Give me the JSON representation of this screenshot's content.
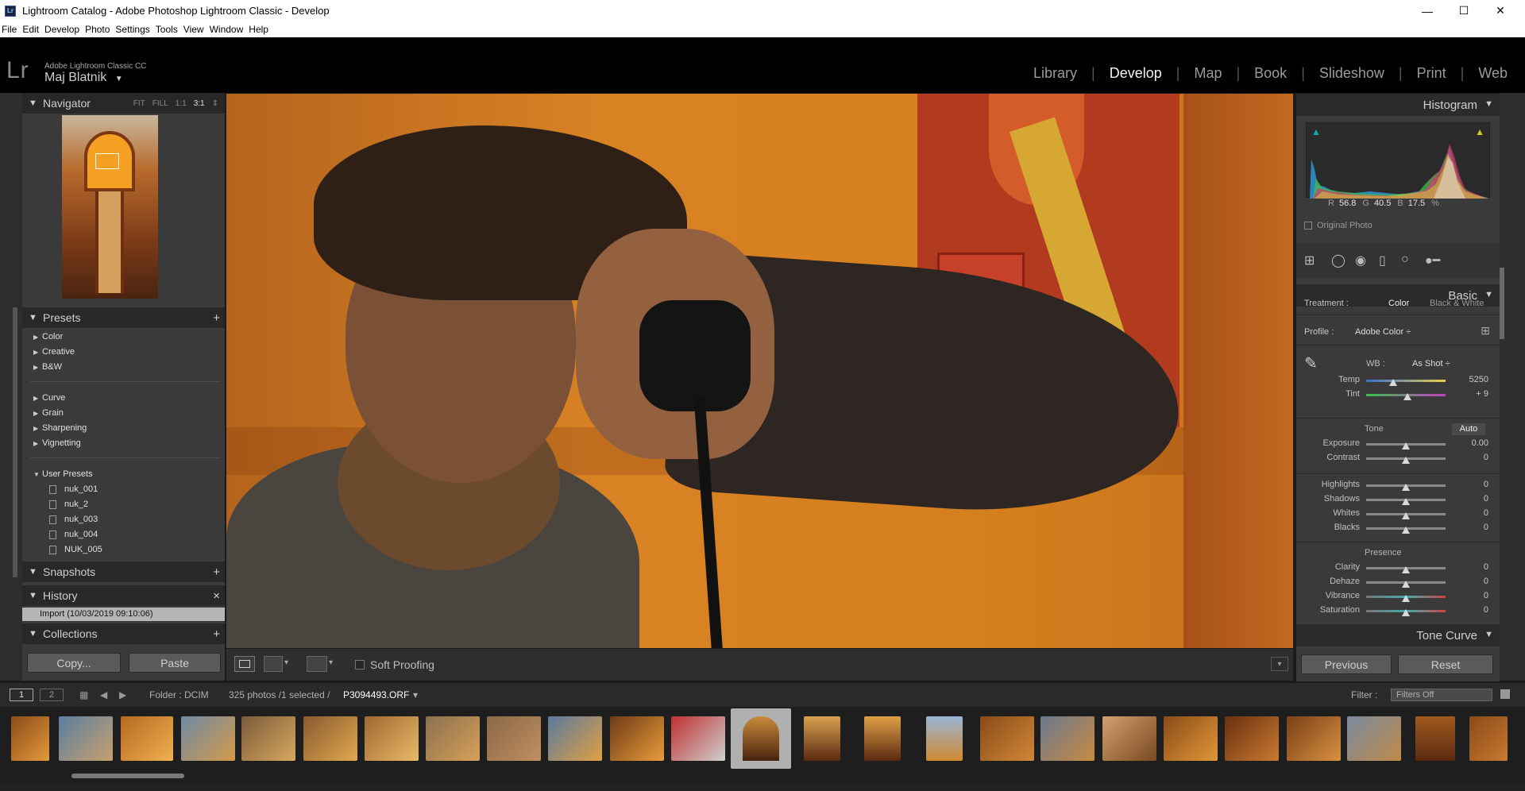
{
  "window": {
    "title": "Lightroom Catalog - Adobe Photoshop Lightroom Classic - Develop",
    "minimize": "—",
    "maximize": "☐",
    "close": "✕",
    "app_badge": "Lr"
  },
  "menu": [
    "File",
    "Edit",
    "Develop",
    "Photo",
    "Settings",
    "Tools",
    "View",
    "Window",
    "Help"
  ],
  "identity": {
    "logo": "Lr",
    "app_name": "Adobe Lightroom Classic CC",
    "user": "Maj Blatnik",
    "user_caret": "▼"
  },
  "modules": [
    "Library",
    "Develop",
    "Map",
    "Book",
    "Slideshow",
    "Print",
    "Web"
  ],
  "active_module": "Develop",
  "left_panel": {
    "navigator": {
      "title": "Navigator",
      "options": [
        "FIT",
        "FILL",
        "1:1",
        "3:1"
      ],
      "active_option": "3:1",
      "chevron": "⇕"
    },
    "presets": {
      "title": "Presets",
      "groups_a": [
        "Color",
        "Creative",
        "B&W"
      ],
      "groups_b": [
        "Curve",
        "Grain",
        "Sharpening",
        "Vignetting"
      ],
      "user_group": "User Presets",
      "user_presets": [
        "nuk_001",
        "nuk_2",
        "nuk_003",
        "nuk_004",
        "NUK_005"
      ]
    },
    "snapshots": {
      "title": "Snapshots"
    },
    "history": {
      "title": "History",
      "item": "Import (10/03/2019 09:10:06)"
    },
    "collections": {
      "title": "Collections"
    },
    "copy": "Copy...",
    "paste": "Paste",
    "plus": "+",
    "close_x": "×",
    "collapse": "▼",
    "expand": "▶"
  },
  "toolbar": {
    "soft_proofing": "Soft Proofing",
    "view_icon": "▭",
    "arrow": "▾"
  },
  "right_panel": {
    "histogram": {
      "title": "Histogram",
      "r_label": "R",
      "r": "56.8",
      "g_label": "G",
      "g": "40.5",
      "b_label": "B",
      "b": "17.5",
      "unit": "%",
      "original_photo": "Original Photo"
    },
    "basic": {
      "title": "Basic",
      "treatment_label": "Treatment :",
      "treatment_color": "Color",
      "treatment_bw": "Black & White",
      "profile_label": "Profile :",
      "profile_value": "Adobe Color ÷",
      "wb_label": "WB :",
      "wb_value": "As Shot ÷",
      "temp_label": "Temp",
      "temp": "5250",
      "tint_label": "Tint",
      "tint": "+ 9",
      "tone_label": "Tone",
      "auto": "Auto",
      "exposure_label": "Exposure",
      "exposure": "0.00",
      "contrast_label": "Contrast",
      "contrast": "0",
      "highlights_label": "Highlights",
      "highlights": "0",
      "shadows_label": "Shadows",
      "shadows": "0",
      "whites_label": "Whites",
      "whites": "0",
      "blacks_label": "Blacks",
      "blacks": "0",
      "presence_label": "Presence",
      "clarity_label": "Clarity",
      "clarity": "0",
      "dehaze_label": "Dehaze",
      "dehaze": "0",
      "vibrance_label": "Vibrance",
      "vibrance": "0",
      "saturation_label": "Saturation",
      "saturation": "0"
    },
    "tone_curve": {
      "title": "Tone Curve"
    },
    "previous": "Previous",
    "reset": "Reset"
  },
  "filmstrip": {
    "page1": "1",
    "page2": "2",
    "folder": "Folder : DCIM",
    "count": "325 photos /1 selected /",
    "filename": "P3094493.ORF",
    "filename_caret": "▾",
    "filter_label": "Filter :",
    "filter_value": "Filters Off"
  },
  "colors": {
    "panel_bg": "#3a3a3a",
    "panel_head": "#282828",
    "photo_orange": "#d98224",
    "accent_selected": "#b0b0b0"
  }
}
